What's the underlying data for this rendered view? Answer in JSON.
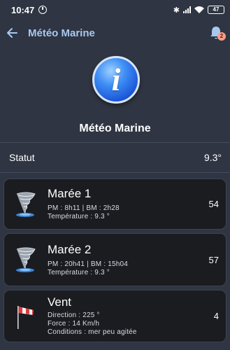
{
  "status_bar": {
    "time": "10:47",
    "battery": "47"
  },
  "app_bar": {
    "title": "Météo Marine",
    "notification_count": "2"
  },
  "hero": {
    "title": "Météo Marine"
  },
  "statut": {
    "label": "Statut",
    "value": "9.3°"
  },
  "cards": [
    {
      "icon": "tornado-icon",
      "title": "Marée 1",
      "line1": "PM : 8h11 | BM : 2h28",
      "line2": "Température : 9.3 °",
      "value": "54"
    },
    {
      "icon": "tornado-icon",
      "title": "Marée 2",
      "line1": "PM : 20h41 | BM : 15h04",
      "line2": "Température : 9.3 °",
      "value": "57"
    },
    {
      "icon": "windsock-icon",
      "title": "Vent",
      "line1": "Direction : 225 °",
      "line2": "Force : 14 Km/h",
      "line3": "Conditions : mer peu agitée",
      "value": "4"
    }
  ],
  "colors": {
    "background": "#2f3542",
    "card": "#1b1c20",
    "accent": "#a8c8f0",
    "badge": "#f5a08a"
  }
}
